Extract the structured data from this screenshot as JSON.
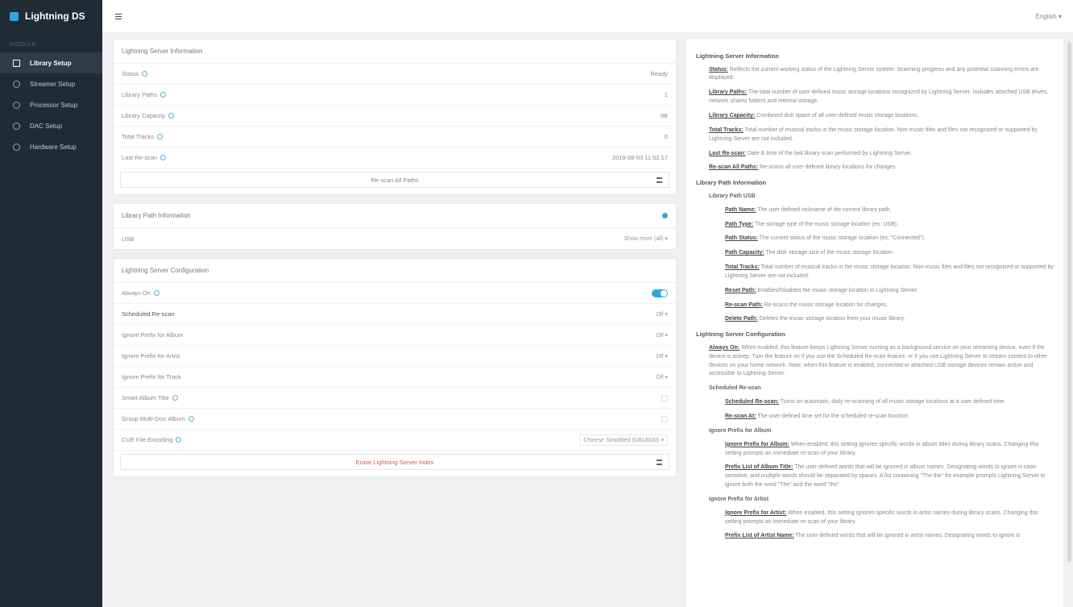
{
  "brand": {
    "name": "Lightning DS"
  },
  "sidebar": {
    "section": "MODULE",
    "items": [
      {
        "label": "Library Setup",
        "active": true
      },
      {
        "label": "Streamer Setup"
      },
      {
        "label": "Processor Setup"
      },
      {
        "label": "DAC Setup"
      },
      {
        "label": "Hardware Setup"
      }
    ]
  },
  "topbar": {
    "language": "English ▾"
  },
  "server_info": {
    "title": "Lightning Server Information",
    "rows": [
      {
        "label": "Status",
        "value": "Ready"
      },
      {
        "label": "Library Paths",
        "value": "1"
      },
      {
        "label": "Library Capacity",
        "value": "0B"
      },
      {
        "label": "Total Tracks",
        "value": "0"
      },
      {
        "label": "Last Re-scan",
        "value": "2019-08-03 11:52:17"
      }
    ],
    "rescan_label": "Re-scan All Paths"
  },
  "path_info": {
    "title": "Library Path Information",
    "row_label": "USB",
    "row_action": "Show more (all) ▾"
  },
  "config": {
    "title": "Lightning Server Configuration",
    "always_on": "Always On",
    "scheduled": {
      "label": "Scheduled Re-scan",
      "value": "Off ▾"
    },
    "ignore_album": {
      "label": "Ignore Prefix for Album",
      "value": "Off ▾"
    },
    "ignore_artist": {
      "label": "Ignore Prefix for Artist",
      "value": "Off ▾"
    },
    "ignore_track": {
      "label": "Ignore Prefix for Track",
      "value": "Off ▾"
    },
    "smart_album": "Smart Album Title",
    "group_multi": "Group Multi-Disc Album",
    "cue": {
      "label": "CUE File Encoding",
      "value": "Chinese Simplified (GB18030) ▾"
    },
    "erase_label": "Erase Lightning Server Index"
  },
  "help": {
    "s1_title": "Lightning Server Information",
    "p_status_t": "Status:",
    "p_status": "Reflects the current working status of the Lightning Server system. Scanning progress and any potential scanning errors are displayed.",
    "p_paths_t": "Library Paths:",
    "p_paths": "The total number of user-defined music storage locations recognized by Lightning Server. Includes attached USB drives, network shares folders and internal storage.",
    "p_cap_t": "Library Capacity:",
    "p_cap": "Combined disk space of all user-defined music storage locations.",
    "p_tracks_t": "Total Tracks:",
    "p_tracks": "Total number of musical tracks in the music storage location. Non-music files and files not recognized or supported by Lightning Server are not included.",
    "p_last_t": "Last Re-scan:",
    "p_last": "Date & time of the last library scan performed by Lightning Server.",
    "p_rescan_t": "Re-scan All Paths:",
    "p_rescan": "Re-scans all user-defined library locations for changes.",
    "s2_title": "Library Path Information",
    "s2_sub": "Library Path USB",
    "p_pname_t": "Path Name:",
    "p_pname": "The user defined nickname of the current library path.",
    "p_ptype_t": "Path Type:",
    "p_ptype": "The storage type of the music storage location (ex: USB).",
    "p_pstatus_t": "Path Status:",
    "p_pstatus": "The current status of the music storage location (ex: \"Connected\").",
    "p_pcap_t": "Path Capacity:",
    "p_pcap": "The disk storage size of the music storage location.",
    "p_ptracks_t": "Total Tracks:",
    "p_ptracks": "Total number of musical tracks in the music storage location. Non-music files and files not recognized or supported by Lightning Server are not included.",
    "p_reset_t": "Reset Path:",
    "p_reset": "Enables/Disables the music storage location in Lightning Server.",
    "p_prescan_t": "Re-scan Path:",
    "p_prescan": "Re-scans the music storage location for changes.",
    "p_delete_t": "Delete Path:",
    "p_delete": "Deletes the music storage location from your music library.",
    "s3_title": "Lightning Server Configuration",
    "p_always_t": "Always On:",
    "p_always": "When enabled, this feature keeps Lightning Server running as a background service on your streaming device, even if the device is asleep. Turn the feature on if you use the Scheduled Re-scan feature, or if you use Lightning Server to stream content to other devices on your home network. Note: when this feature is enabled, connected or attached USB storage devices remain active and accessible to Lightning Server.",
    "s3_sub1": "Scheduled Re-scan",
    "p_sched_t": "Scheduled Re-scan:",
    "p_sched": "Turns on automatic, daily re-scanning of all music storage locations at a user defined time.",
    "p_rescanat_t": "Re-scan At:",
    "p_rescanat": "The user-defined time set for the scheduled re-scan function.",
    "s3_sub2": "Ignore Prefix for Album",
    "p_igalbum_t": "Ignore Prefix for Album:",
    "p_igalbum": "When enabled, this setting ignores specific words in album titles during library scans. Changing this setting prompts an immediate re-scan of your library.",
    "p_plalbum_t": "Prefix List of Album Title:",
    "p_plalbum": "The user-defined words that will be ignored in album names. Designating words to ignore is case-sensitive, and multiple words should be separated by spaces. A list containing \"The the\" for example prompts Lightning Server to ignore both the word \"The\" and the word \"the\".",
    "s3_sub3": "Ignore Prefix for Artist",
    "p_igartist_t": "Ignore Prefix for Artist:",
    "p_igartist": "When enabled, this setting ignores specific words in artist names during library scans. Changing this setting prompts an immediate re-scan of your library.",
    "p_plartist_t": "Prefix List of Artist Name:",
    "p_plartist": "The user-defined words that will be ignored in artist names. Designating words to ignore is"
  }
}
